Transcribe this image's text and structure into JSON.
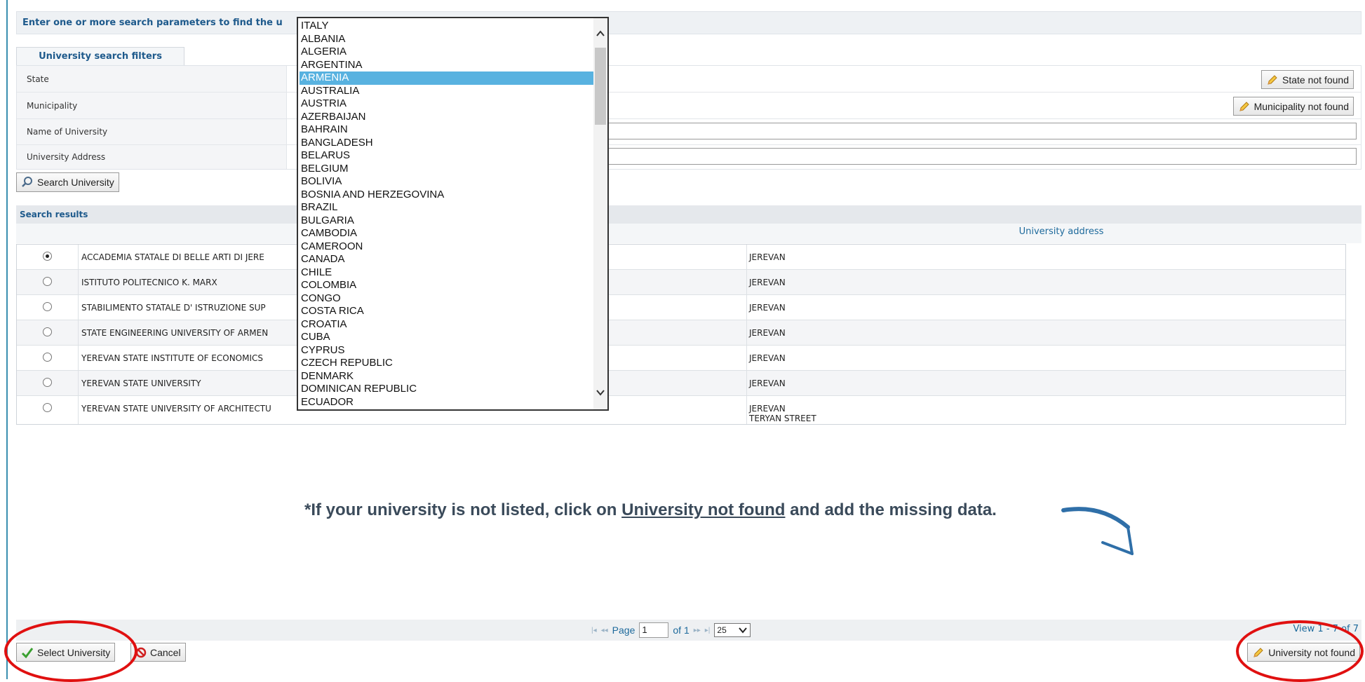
{
  "header": {
    "instruction": "Enter one or more search parameters to find the u"
  },
  "filters": {
    "tab_label": "University search filters",
    "state_label": "State",
    "municipality_label": "Municipality",
    "name_label": "Name of University",
    "address_label": "University Address",
    "state_not_found": "State not found",
    "municipality_not_found": "Municipality not found",
    "search_button": "Search University"
  },
  "results": {
    "title": "Search results",
    "col_address": "University address",
    "rows": [
      {
        "name": "ACCADEMIA STATALE DI BELLE ARTI DI JERE",
        "address": "JEREVAN",
        "address2": "",
        "selected": true
      },
      {
        "name": "ISTITUTO POLITECNICO K. MARX",
        "address": "JEREVAN",
        "address2": "",
        "selected": false
      },
      {
        "name": "STABILIMENTO STATALE D' ISTRUZIONE SUP",
        "address": "JEREVAN",
        "address2": "",
        "selected": false
      },
      {
        "name": "STATE ENGINEERING UNIVERSITY OF ARMEN",
        "address": "JEREVAN",
        "address2": "",
        "selected": false
      },
      {
        "name": "YEREVAN STATE INSTITUTE OF ECONOMICS",
        "address": "JEREVAN",
        "address2": "",
        "selected": false
      },
      {
        "name": "YEREVAN STATE UNIVERSITY",
        "address": "JEREVAN",
        "address2": "",
        "selected": false
      },
      {
        "name": "YEREVAN STATE UNIVERSITY OF ARCHITECTU",
        "address": "JEREVAN",
        "address2": "TERYAN STREET",
        "selected": false
      }
    ]
  },
  "note": {
    "prefix": "*If your university is not listed, click on ",
    "link": "University not found",
    "suffix": " and add the missing data."
  },
  "pager": {
    "page_label": "Page",
    "page_value": "1",
    "of_label": "of 1",
    "rows_per_page": "25",
    "view_text": "View 1 - 7 of 7"
  },
  "footer": {
    "select_button": "Select University",
    "cancel_button": "Cancel",
    "not_found_button": "University not found"
  },
  "dropdown": {
    "selected": "ARMENIA",
    "options": [
      "ITALY",
      "ALBANIA",
      "ALGERIA",
      "ARGENTINA",
      "ARMENIA",
      "AUSTRALIA",
      "AUSTRIA",
      "AZERBAIJAN",
      "BAHRAIN",
      "BANGLADESH",
      "BELARUS",
      "BELGIUM",
      "BOLIVIA",
      "BOSNIA AND HERZEGOVINA",
      "BRAZIL",
      "BULGARIA",
      "CAMBODIA",
      "CAMEROON",
      "CANADA",
      "CHILE",
      "COLOMBIA",
      "CONGO",
      "COSTA RICA",
      "CROATIA",
      "CUBA",
      "CYPRUS",
      "CZECH REPUBLIC",
      "DENMARK",
      "DOMINICAN REPUBLIC",
      "ECUADOR"
    ]
  },
  "colors": {
    "accent": "#1e5a8c",
    "highlight": "#58b2e0",
    "annotation": "#e01010",
    "arrow": "#2f6fa8"
  }
}
